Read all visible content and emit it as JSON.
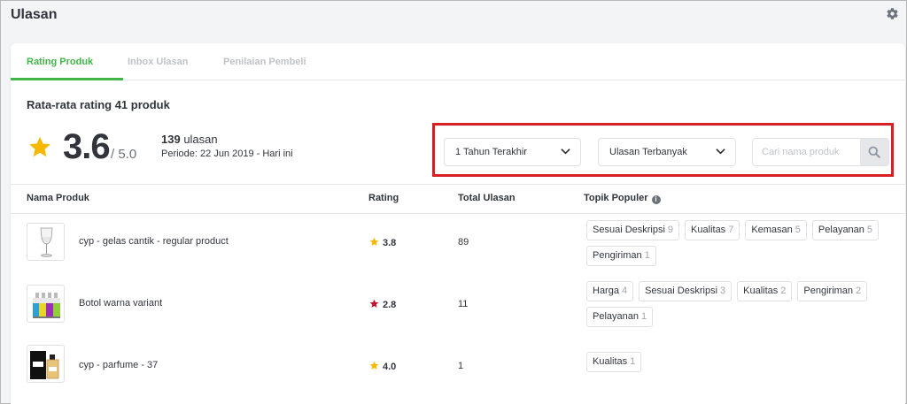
{
  "page": {
    "title": "Ulasan"
  },
  "tabs": [
    {
      "label": "Rating Produk",
      "active": true
    },
    {
      "label": "Inbox Ulasan",
      "active": false
    },
    {
      "label": "Penilaian Pembeli",
      "active": false
    }
  ],
  "summary": {
    "title": "Rata-rata rating 41 produk",
    "rating": "3.6",
    "max": "/ 5.0",
    "review_count": "139",
    "review_unit": " ulasan",
    "period": "Periode: 22 Jun 2019 - Hari ini"
  },
  "filters": {
    "period_select": "1 Tahun Terakhir",
    "sort_select": "Ulasan Terbanyak",
    "search_placeholder": "Cari nama produk",
    "highlight_color": "#d71f26"
  },
  "table": {
    "headers": {
      "name": "Nama Produk",
      "rating": "Rating",
      "total": "Total Ulasan",
      "topics": "Topik Populer"
    },
    "rows": [
      {
        "name": "cyp - gelas cantik - regular product",
        "rating": "3.8",
        "star_color": "#f8b800",
        "total": "89",
        "thumb": "wine-glass",
        "topics": [
          {
            "label": "Sesuai Deskripsi",
            "count": "9"
          },
          {
            "label": "Kualitas",
            "count": "7"
          },
          {
            "label": "Kemasan",
            "count": "5"
          },
          {
            "label": "Pelayanan",
            "count": "5"
          },
          {
            "label": "Pengiriman",
            "count": "1"
          }
        ]
      },
      {
        "name": "Botol warna variant",
        "rating": "2.8",
        "star_color": "#c4122f",
        "total": "11",
        "thumb": "colored-bottles",
        "topics": [
          {
            "label": "Harga",
            "count": "4"
          },
          {
            "label": "Sesuai Deskripsi",
            "count": "3"
          },
          {
            "label": "Kualitas",
            "count": "2"
          },
          {
            "label": "Pengiriman",
            "count": "2"
          },
          {
            "label": "Pelayanan",
            "count": "1"
          }
        ]
      },
      {
        "name": "cyp - parfume - 37",
        "rating": "4.0",
        "star_color": "#f8b800",
        "total": "1",
        "thumb": "perfume",
        "topics": [
          {
            "label": "Kualitas",
            "count": "1"
          }
        ]
      }
    ]
  },
  "colors": {
    "accent": "#42b549",
    "star": "#f8b800"
  }
}
